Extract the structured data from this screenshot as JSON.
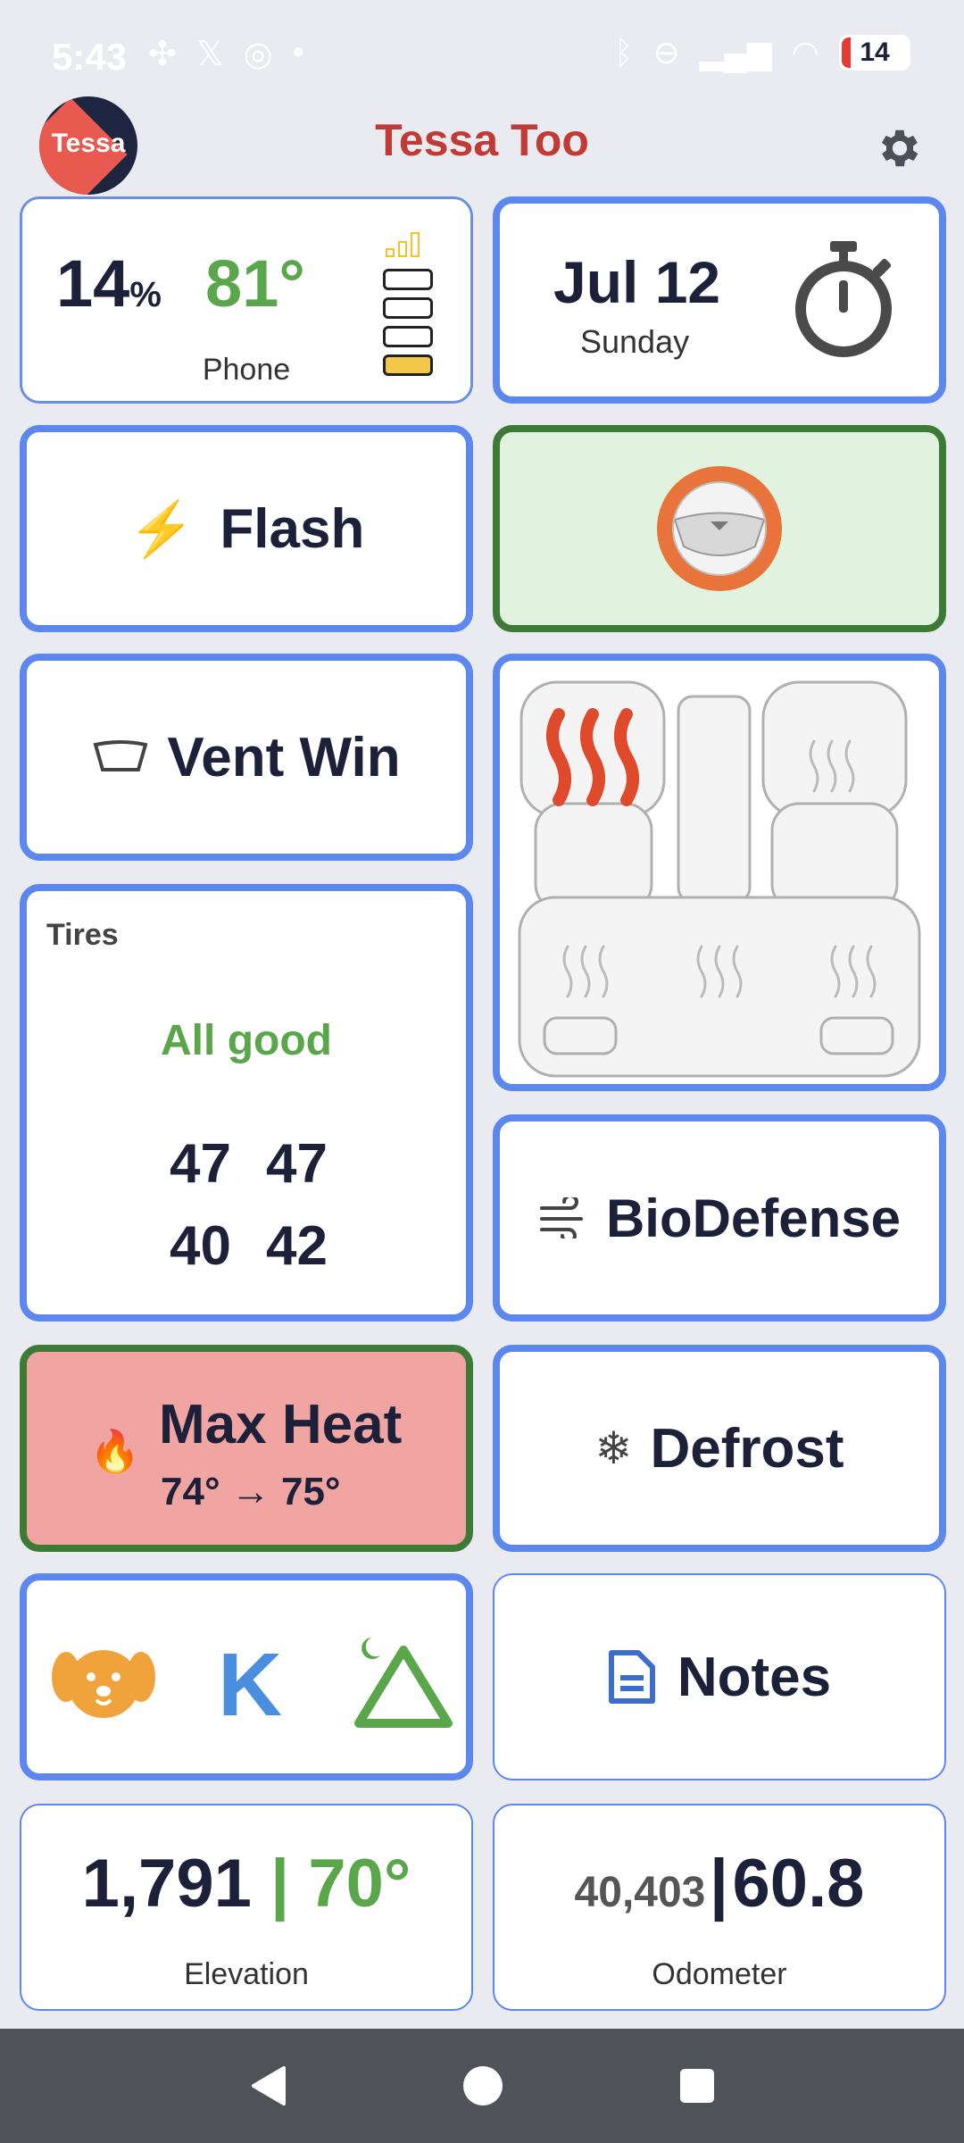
{
  "status": {
    "time": "5:43",
    "battery_percent": "14",
    "battery_level": 0.14
  },
  "header": {
    "avatar_label": "Tessa",
    "title": "Tessa Too"
  },
  "phone": {
    "battery": "14",
    "battery_unit": "%",
    "temp": "81°",
    "label": "Phone",
    "signal_bars": 1
  },
  "date": {
    "day": "Jul 12",
    "weekday": "Sunday"
  },
  "flash": {
    "label": "Flash"
  },
  "vent": {
    "label": "Vent Win"
  },
  "tires": {
    "heading": "Tires",
    "status": "All good",
    "fl": "47",
    "fr": "47",
    "rl": "40",
    "rr": "42"
  },
  "biodefense": {
    "label": "BioDefense"
  },
  "maxheat": {
    "label": "Max Heat",
    "temps": "74° → 75°"
  },
  "defrost": {
    "label": "Defrost"
  },
  "shortcuts": {
    "middle": "K"
  },
  "notes": {
    "label": "Notes"
  },
  "elevation": {
    "value": "1,791",
    "sep": "|",
    "temp": "70°",
    "label": "Elevation"
  },
  "odometer": {
    "miles": "40,403",
    "sep": "|",
    "value": "60.8",
    "label": "Odometer"
  },
  "colors": {
    "accent_red": "#c23a34",
    "green": "#5aa64a",
    "blue": "#5b87ef",
    "heat_bg": "#f1a5a3",
    "wheel_bg": "#e1f3df"
  }
}
